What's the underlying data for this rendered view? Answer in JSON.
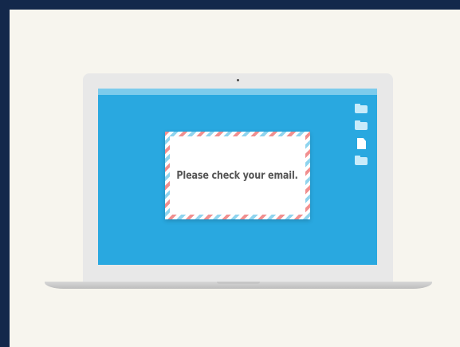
{
  "screen": {
    "dialog": {
      "message": "Please check your email."
    },
    "desktop_icons": [
      {
        "icon": "folder-icon"
      },
      {
        "icon": "folder-icon"
      },
      {
        "icon": "document-icon"
      },
      {
        "icon": "folder-icon"
      }
    ]
  },
  "colors": {
    "page_border": "#13284b",
    "page_background": "#f7f5ee",
    "screen": "#29a8e0",
    "stripe_red": "#f08f8f",
    "stripe_blue": "#8fd4ee",
    "message_text": "#555555"
  }
}
